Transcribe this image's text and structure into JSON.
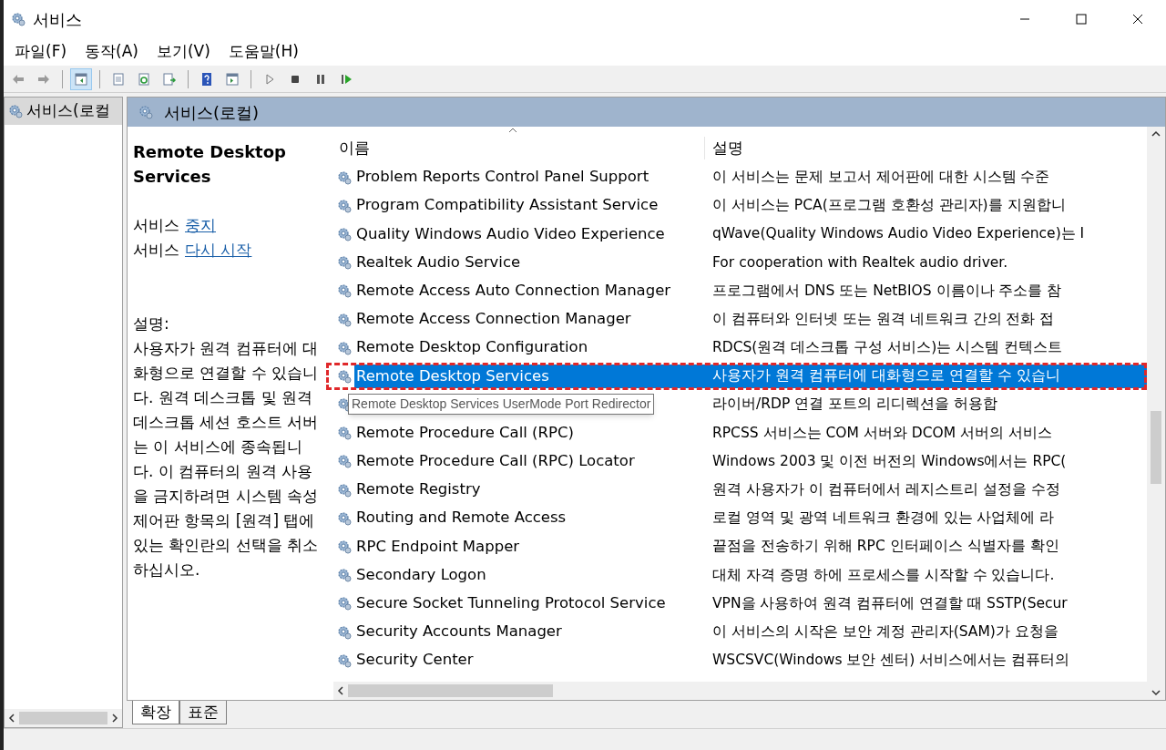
{
  "window": {
    "title": "서비스"
  },
  "menu": [
    "파일(F)",
    "동작(A)",
    "보기(V)",
    "도움말(H)"
  ],
  "toolbar": [
    {
      "kind": "back",
      "pressed": false
    },
    {
      "kind": "forward",
      "pressed": false
    },
    {
      "kind": "sep"
    },
    {
      "kind": "tree",
      "pressed": true
    },
    {
      "kind": "sep"
    },
    {
      "kind": "properties",
      "pressed": false
    },
    {
      "kind": "refresh",
      "pressed": false
    },
    {
      "kind": "export",
      "pressed": false
    },
    {
      "kind": "sep"
    },
    {
      "kind": "help",
      "pressed": false
    },
    {
      "kind": "panel",
      "pressed": false
    },
    {
      "kind": "sep"
    },
    {
      "kind": "play",
      "pressed": false
    },
    {
      "kind": "stop",
      "pressed": false
    },
    {
      "kind": "pause",
      "pressed": false
    },
    {
      "kind": "resume",
      "pressed": false
    }
  ],
  "tree": {
    "items": [
      {
        "label": "서비스(로컬",
        "selected": true
      }
    ]
  },
  "panel_header": "서비스(로컬)",
  "details": {
    "title": "Remote Desktop Services",
    "actions": [
      {
        "prefix": "서비스",
        "link": "중지"
      },
      {
        "prefix": "서비스",
        "link": "다시 시작"
      }
    ],
    "description_label": "설명:",
    "description": "사용자가 원격 컴퓨터에 대화형으로 연결할 수 있습니다. 원격 데스크톱 및 원격 데스크톱 세션 호스트 서버는 이 서비스에 종속됩니다. 이 컴퓨터의 원격 사용을 금지하려면 시스템 속성 제어판 항목의 [원격] 탭에 있는 확인란의 선택을 취소하십시오."
  },
  "table": {
    "columns": [
      "이름",
      "설명"
    ],
    "rows": [
      {
        "name": "Problem Reports Control Panel Support",
        "description": "이 서비스는 문제 보고서 제어판에 대한 시스템 수준",
        "selected": false,
        "annotated": false
      },
      {
        "name": "Program Compatibility Assistant Service",
        "description": "이 서비스는 PCA(프로그램 호환성 관리자)를 지원합니",
        "selected": false,
        "annotated": false
      },
      {
        "name": "Quality Windows Audio Video Experience",
        "description": "qWave(Quality Windows Audio Video Experience)는 I",
        "selected": false,
        "annotated": false
      },
      {
        "name": "Realtek Audio Service",
        "description": "For cooperation with Realtek audio driver.",
        "selected": false,
        "annotated": false
      },
      {
        "name": "Remote Access Auto Connection Manager",
        "description": "프로그램에서 DNS 또는 NetBIOS 이름이나 주소를 참",
        "selected": false,
        "annotated": false
      },
      {
        "name": "Remote Access Connection Manager",
        "description": "이 컴퓨터와 인터넷 또는 원격 네트워크 간의 전화 접",
        "selected": false,
        "annotated": false
      },
      {
        "name": "Remote Desktop Configuration",
        "description": "RDCS(원격 데스크톱 구성 서비스)는 시스템 컨텍스트",
        "selected": false,
        "annotated": false
      },
      {
        "name": "Remote Desktop Services",
        "description": "사용자가 원격 컴퓨터에 대화형으로 연결할 수 있습니",
        "selected": true,
        "annotated": true
      },
      {
        "description": "라이버/RDP 연결 포트의 리디렉션을 허용합",
        "selected": false,
        "annotated": false,
        "tooltip": "Remote Desktop Services UserMode Port Redirector"
      },
      {
        "name": "Remote Procedure Call (RPC)",
        "description": "RPCSS 서비스는 COM 서버와 DCOM 서버의 서비스",
        "selected": false,
        "annotated": false
      },
      {
        "name": "Remote Procedure Call (RPC) Locator",
        "description": "Windows 2003 및 이전 버전의 Windows에서는 RPC(",
        "selected": false,
        "annotated": false
      },
      {
        "name": "Remote Registry",
        "description": "원격 사용자가 이 컴퓨터에서 레지스트리 설정을 수정",
        "selected": false,
        "annotated": false
      },
      {
        "name": "Routing and Remote Access",
        "description": "로컬 영역 및 광역 네트워크 환경에 있는 사업체에 라",
        "selected": false,
        "annotated": false
      },
      {
        "name": "RPC Endpoint Mapper",
        "description": "끝점을 전송하기 위해 RPC 인터페이스 식별자를 확인",
        "selected": false,
        "annotated": false
      },
      {
        "name": "Secondary Logon",
        "description": "대체 자격 증명 하에 프로세스를 시작할 수 있습니다.",
        "selected": false,
        "annotated": false
      },
      {
        "name": "Secure Socket Tunneling Protocol Service",
        "description": "VPN을 사용하여 원격 컴퓨터에 연결할 때 SSTP(Secur",
        "selected": false,
        "annotated": false
      },
      {
        "name": "Security Accounts Manager",
        "description": "이 서비스의 시작은 보안 계정 관리자(SAM)가 요청을",
        "selected": false,
        "annotated": false
      },
      {
        "name": "Security Center",
        "description": "WSCSVC(Windows 보안 센터) 서비스에서는 컴퓨터의",
        "selected": false,
        "annotated": false
      }
    ]
  },
  "tabs": [
    {
      "label": "확장",
      "selected": true
    },
    {
      "label": "표준",
      "selected": false
    }
  ]
}
